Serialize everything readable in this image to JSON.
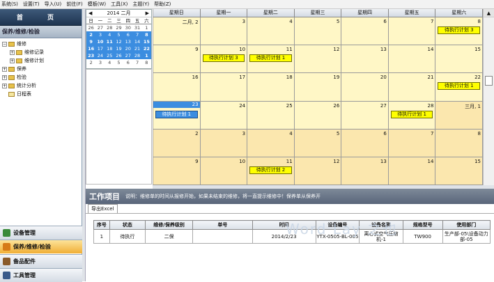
{
  "menu": [
    "系统(S)",
    "设置(T)",
    "导入(U)",
    "前往(F)",
    "模板(W)",
    "工具(X)",
    "主题(Y)",
    "帮助(Z)"
  ],
  "sidebar": {
    "home_label": "首 页",
    "section_title": "保养/维修/检验",
    "tree": [
      {
        "label": "维修",
        "level": 0,
        "toggle": "−",
        "folder": false
      },
      {
        "label": "维修记录",
        "level": 1,
        "toggle": "+",
        "folder": false
      },
      {
        "label": "维修计划",
        "level": 1,
        "toggle": "+",
        "folder": false
      },
      {
        "label": "保养",
        "level": 0,
        "toggle": "+",
        "folder": false
      },
      {
        "label": "检验",
        "level": 0,
        "toggle": "+",
        "folder": false
      },
      {
        "label": "统计分析",
        "level": 0,
        "toggle": "+",
        "folder": false
      },
      {
        "label": "日程表",
        "level": 0,
        "toggle": "",
        "folder": true
      }
    ],
    "bottom_nav": [
      {
        "label": "设备管理",
        "icon": "equipment-icon",
        "color": "#3a8a3a",
        "selected": false
      },
      {
        "label": "保养/维修/检验",
        "icon": "maintenance-icon",
        "color": "#d67a18",
        "selected": true
      },
      {
        "label": "备品配件",
        "icon": "parts-icon",
        "color": "#8a5a2a",
        "selected": false
      },
      {
        "label": "工具管理",
        "icon": "tools-icon",
        "color": "#3a5a8a",
        "selected": false
      }
    ]
  },
  "mini_calendar": {
    "title": "2014 二月",
    "prev": "◀",
    "next": "▶",
    "day_headers": [
      "日",
      "一",
      "二",
      "三",
      "四",
      "五",
      "六"
    ],
    "weeks": [
      [
        "26",
        "27",
        "28",
        "29",
        "30",
        "31",
        "1"
      ],
      [
        "2",
        "3",
        "4",
        "5",
        "6",
        "7",
        "8"
      ],
      [
        "9",
        "10",
        "11",
        "12",
        "13",
        "14",
        "15"
      ],
      [
        "16",
        "17",
        "18",
        "19",
        "20",
        "21",
        "22"
      ],
      [
        "23",
        "24",
        "25",
        "26",
        "27",
        "28",
        "1"
      ],
      [
        "2",
        "3",
        "4",
        "5",
        "6",
        "7",
        "8"
      ]
    ]
  },
  "calendar": {
    "headers": [
      "星期日",
      "星期一",
      "星期二",
      "星期三",
      "星期四",
      "星期五",
      "星期六"
    ],
    "weeks": [
      [
        {
          "d": "二月, 2"
        },
        {
          "d": "3"
        },
        {
          "d": "4"
        },
        {
          "d": "5"
        },
        {
          "d": "6"
        },
        {
          "d": "7"
        },
        {
          "d": "8",
          "ev": "待执行计划 3"
        }
      ],
      [
        {
          "d": "9"
        },
        {
          "d": "10",
          "ev": "待执行计划 3"
        },
        {
          "d": "11",
          "ev": "待执行计划 1"
        },
        {
          "d": "12"
        },
        {
          "d": "13"
        },
        {
          "d": "14"
        },
        {
          "d": "15"
        }
      ],
      [
        {
          "d": "16"
        },
        {
          "d": "17"
        },
        {
          "d": "18"
        },
        {
          "d": "19"
        },
        {
          "d": "20"
        },
        {
          "d": "21"
        },
        {
          "d": "22",
          "ev": "待执行计划 1"
        }
      ],
      [
        {
          "d": "23",
          "ev": "待执行计划 1",
          "today": true
        },
        {
          "d": "24"
        },
        {
          "d": "25"
        },
        {
          "d": "26"
        },
        {
          "d": "27"
        },
        {
          "d": "28",
          "ev": "待执行计划 1"
        },
        {
          "d": "三月, 1",
          "other": true
        }
      ],
      [
        {
          "d": "2",
          "other": true
        },
        {
          "d": "3",
          "other": true
        },
        {
          "d": "4",
          "other": true
        },
        {
          "d": "5",
          "other": true
        },
        {
          "d": "6",
          "other": true
        },
        {
          "d": "7",
          "other": true
        },
        {
          "d": "8",
          "other": true
        }
      ],
      [
        {
          "d": "9",
          "other": true
        },
        {
          "d": "10",
          "other": true
        },
        {
          "d": "11",
          "other": true,
          "ev": "待执行计划 2"
        },
        {
          "d": "12",
          "other": true
        },
        {
          "d": "13",
          "other": true
        },
        {
          "d": "14",
          "other": true
        },
        {
          "d": "15",
          "other": true
        }
      ]
    ]
  },
  "work": {
    "title": "工作项目",
    "note": "说明：维修单的时间从报修开始，如果未结束的维修，将一直提示维修中！保养单从保养开",
    "export_tab": "导出Excel",
    "columns": [
      "序号",
      "状态",
      "维修/保养级别",
      "单号",
      "时间",
      "设备编号",
      "设备名称",
      "规格型号",
      "使用部门"
    ],
    "rows": [
      [
        "1",
        "待执行",
        "二保",
        "",
        "2014/2/23",
        "YTX-0505-BL-005",
        "离心式空气压缩机-1",
        "TW900",
        "生产部-05\\设备动力部-05"
      ]
    ]
  },
  "watermark": "Word Lay 之也"
}
